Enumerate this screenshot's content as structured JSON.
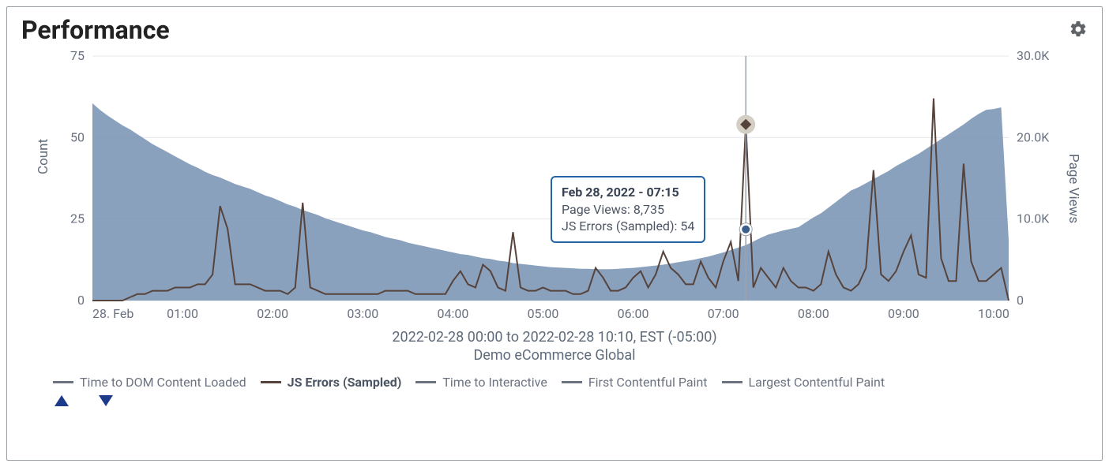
{
  "panel": {
    "title": "Performance",
    "date_range": "2022-02-28 00:00 to 2022-02-28 10:10, EST (-05:00)",
    "site_name": "Demo eCommerce Global"
  },
  "axes": {
    "left_title": "Count",
    "right_title": "Page Views",
    "left_ticks": [
      "0",
      "25",
      "50",
      "75"
    ],
    "right_ticks": [
      "0",
      "10.0K",
      "20.0K",
      "30.0K"
    ],
    "x_ticks": [
      "28. Feb",
      "01:00",
      "02:00",
      "03:00",
      "04:00",
      "05:00",
      "06:00",
      "07:00",
      "08:00",
      "09:00",
      "10:00"
    ]
  },
  "tooltip": {
    "header": "Feb 28, 2022 - 07:15",
    "line1_label": "Page Views",
    "line1_value": "8,735",
    "line2_label": "JS Errors (Sampled)",
    "line2_value": "54"
  },
  "legend": {
    "items": [
      {
        "label": "Time to DOM Content Loaded",
        "color": "gray",
        "bold": false
      },
      {
        "label": "JS Errors (Sampled)",
        "color": "brown",
        "bold": true
      },
      {
        "label": "Time to Interactive",
        "color": "gray",
        "bold": false
      },
      {
        "label": "First Contentful Paint",
        "color": "gray",
        "bold": false
      },
      {
        "label": "Largest Contentful Paint",
        "color": "gray",
        "bold": false
      }
    ]
  },
  "colors": {
    "area": "#7590b2",
    "line": "#56433c",
    "grid": "#e5e7eb",
    "axis": "#6b7280",
    "tooltip_border": "#2563a7",
    "marker_ring": "#d4cfc4",
    "marker_fill": "#56433c"
  },
  "chart_data": {
    "type": "area+line",
    "title": "Performance",
    "xlabel": "",
    "y_left_label": "Count",
    "y_right_label": "Page Views",
    "y_left_range": [
      0,
      75
    ],
    "y_right_range": [
      0,
      30000
    ],
    "x_categories_minutes_from_midnight": [
      0,
      5,
      10,
      15,
      20,
      25,
      30,
      35,
      40,
      45,
      50,
      55,
      60,
      65,
      70,
      75,
      80,
      85,
      90,
      95,
      100,
      105,
      110,
      115,
      120,
      125,
      130,
      135,
      140,
      145,
      150,
      155,
      160,
      165,
      170,
      175,
      180,
      185,
      190,
      195,
      200,
      205,
      210,
      215,
      220,
      225,
      230,
      235,
      240,
      245,
      250,
      255,
      260,
      265,
      270,
      275,
      280,
      285,
      290,
      295,
      300,
      305,
      310,
      315,
      320,
      325,
      330,
      335,
      340,
      345,
      350,
      355,
      360,
      365,
      370,
      375,
      380,
      385,
      390,
      395,
      400,
      405,
      410,
      415,
      420,
      425,
      430,
      435,
      440,
      445,
      450,
      455,
      460,
      465,
      470,
      475,
      480,
      485,
      490,
      495,
      500,
      505,
      510,
      515,
      520,
      525,
      530,
      535,
      540,
      545,
      550,
      555,
      560,
      565,
      570,
      575,
      580,
      585,
      590,
      595,
      600,
      605,
      610
    ],
    "series": [
      {
        "name": "Page Views",
        "axis": "right",
        "type": "area",
        "color": "#7590b2",
        "values": [
          24200,
          23400,
          22700,
          22100,
          21500,
          21000,
          20400,
          19800,
          19200,
          18700,
          18200,
          17700,
          17200,
          16700,
          16300,
          15800,
          15400,
          15100,
          14700,
          14300,
          14000,
          13700,
          13300,
          12900,
          12600,
          12200,
          11800,
          11500,
          11100,
          10800,
          10500,
          10100,
          9800,
          9500,
          9200,
          8900,
          8600,
          8400,
          8100,
          7800,
          7600,
          7400,
          7100,
          6900,
          6700,
          6500,
          6300,
          6100,
          5900,
          5700,
          5600,
          5400,
          5200,
          5100,
          4900,
          4800,
          4600,
          4500,
          4400,
          4300,
          4200,
          4100,
          4050,
          4000,
          3950,
          3900,
          3900,
          3850,
          3850,
          3850,
          3900,
          3950,
          4000,
          4100,
          4200,
          4300,
          4400,
          4550,
          4700,
          4850,
          5000,
          5200,
          5400,
          5650,
          5900,
          6200,
          6500,
          6800,
          7250,
          7700,
          8100,
          8350,
          8600,
          8800,
          9000,
          9600,
          10200,
          10700,
          11400,
          12100,
          12800,
          13500,
          13900,
          14400,
          14900,
          15400,
          15900,
          16500,
          17000,
          17500,
          18000,
          18600,
          19200,
          19800,
          20400,
          21000,
          21600,
          22300,
          22900,
          23400,
          23500,
          23700,
          7400
        ]
      },
      {
        "name": "JS Errors (Sampled)",
        "axis": "left",
        "type": "line",
        "color": "#56433c",
        "values": [
          0,
          0,
          0,
          0,
          0,
          1,
          2,
          2,
          3,
          3,
          3,
          4,
          4,
          4,
          5,
          5,
          8,
          29,
          22,
          5,
          5,
          5,
          4,
          3,
          3,
          3,
          2,
          4,
          30,
          4,
          3,
          2,
          2,
          2,
          2,
          2,
          2,
          2,
          2,
          3,
          3,
          3,
          3,
          2,
          2,
          2,
          2,
          2,
          6,
          9,
          5,
          4,
          11,
          9,
          4,
          3,
          21,
          4,
          3,
          3,
          4,
          3,
          3,
          3,
          2,
          2,
          3,
          10,
          7,
          3,
          3,
          4,
          7,
          9,
          4,
          8,
          15,
          10,
          8,
          5,
          5,
          12,
          7,
          4,
          12,
          18,
          6,
          54,
          4,
          10,
          7,
          4,
          10,
          6,
          4,
          4,
          3,
          5,
          15,
          8,
          4,
          3,
          5,
          10,
          40,
          8,
          6,
          9,
          15,
          20,
          8,
          7,
          62,
          13,
          6,
          6,
          42,
          12,
          6,
          6,
          8,
          10,
          0
        ]
      }
    ],
    "hover_point": {
      "time": "07:15",
      "minute_index": 87,
      "page_views": 8735,
      "js_errors_sampled": 54
    }
  }
}
